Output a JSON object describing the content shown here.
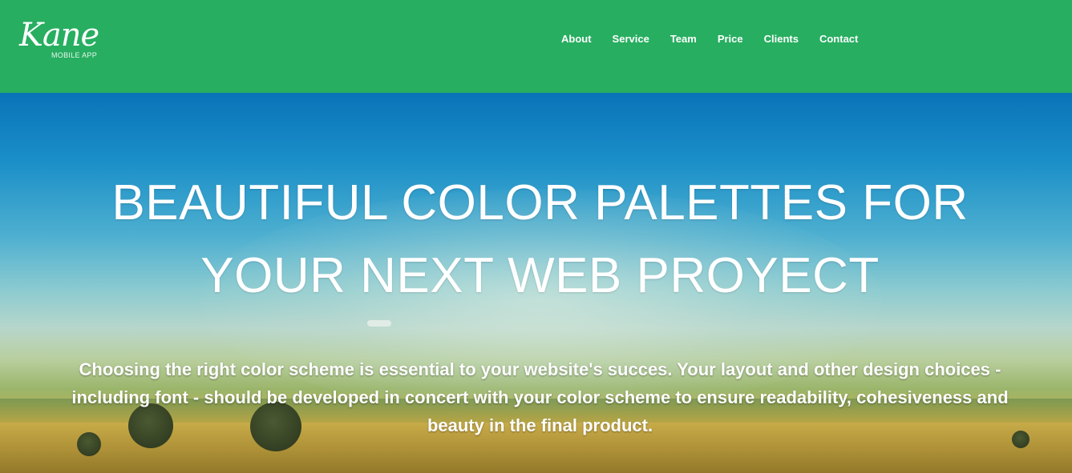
{
  "brand": {
    "name": "Kane",
    "tagline": "MOBILE APP"
  },
  "nav": {
    "items": [
      {
        "label": "About"
      },
      {
        "label": "Service"
      },
      {
        "label": "Team"
      },
      {
        "label": "Price"
      },
      {
        "label": "Clients"
      },
      {
        "label": "Contact"
      }
    ]
  },
  "hero": {
    "title": "BEAUTIFUL COLOR PALETTES FOR YOUR NEXT WEB PROYECT",
    "description": "Choosing the right color scheme is essential to your website's succes. Your layout and other design choices - including font - should be developed in concert with your color scheme to ensure readability, cohesiveness and beauty in the final product."
  },
  "colors": {
    "navbar": "#27ae60",
    "text": "#ffffff"
  }
}
